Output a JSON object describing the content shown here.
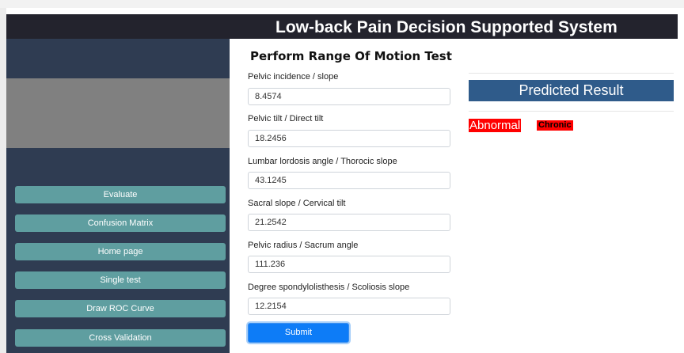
{
  "header": {
    "title": "Low-back Pain Decision Supported System"
  },
  "sidebar": {
    "buttons": [
      {
        "label": "Evaluate"
      },
      {
        "label": "Confusion Matrix"
      },
      {
        "label": "Home page"
      },
      {
        "label": "Single test"
      },
      {
        "label": "Draw ROC Curve"
      },
      {
        "label": "Cross Validation"
      }
    ]
  },
  "form": {
    "title": "Perform Range Of Motion Test",
    "fields": [
      {
        "label": "Pelvic incidence / slope",
        "value": "8.4574"
      },
      {
        "label": "Pelvic tilt / Direct tilt",
        "value": "18.2456"
      },
      {
        "label": "Lumbar lordosis angle / Thorocic slope",
        "value": "43.1245"
      },
      {
        "label": "Sacral slope / Cervical tilt",
        "value": "21.2542"
      },
      {
        "label": "Pelvic radius / Sacrum angle",
        "value": "111.236"
      },
      {
        "label": "Degree spondylolisthesis / Scoliosis slope",
        "value": "12.2154"
      }
    ],
    "submit_label": "Submit"
  },
  "result": {
    "heading": "Predicted Result",
    "primary": "Abnormal",
    "secondary": "Chronic"
  },
  "colors": {
    "header_bg": "#23232d",
    "sidebar_bg": "#2f3c52",
    "button_bg": "#5f9ea0",
    "result_heading_bg": "#2f5b8a",
    "result_highlight": "#ff0000",
    "submit_bg": "#0d7cf7"
  }
}
